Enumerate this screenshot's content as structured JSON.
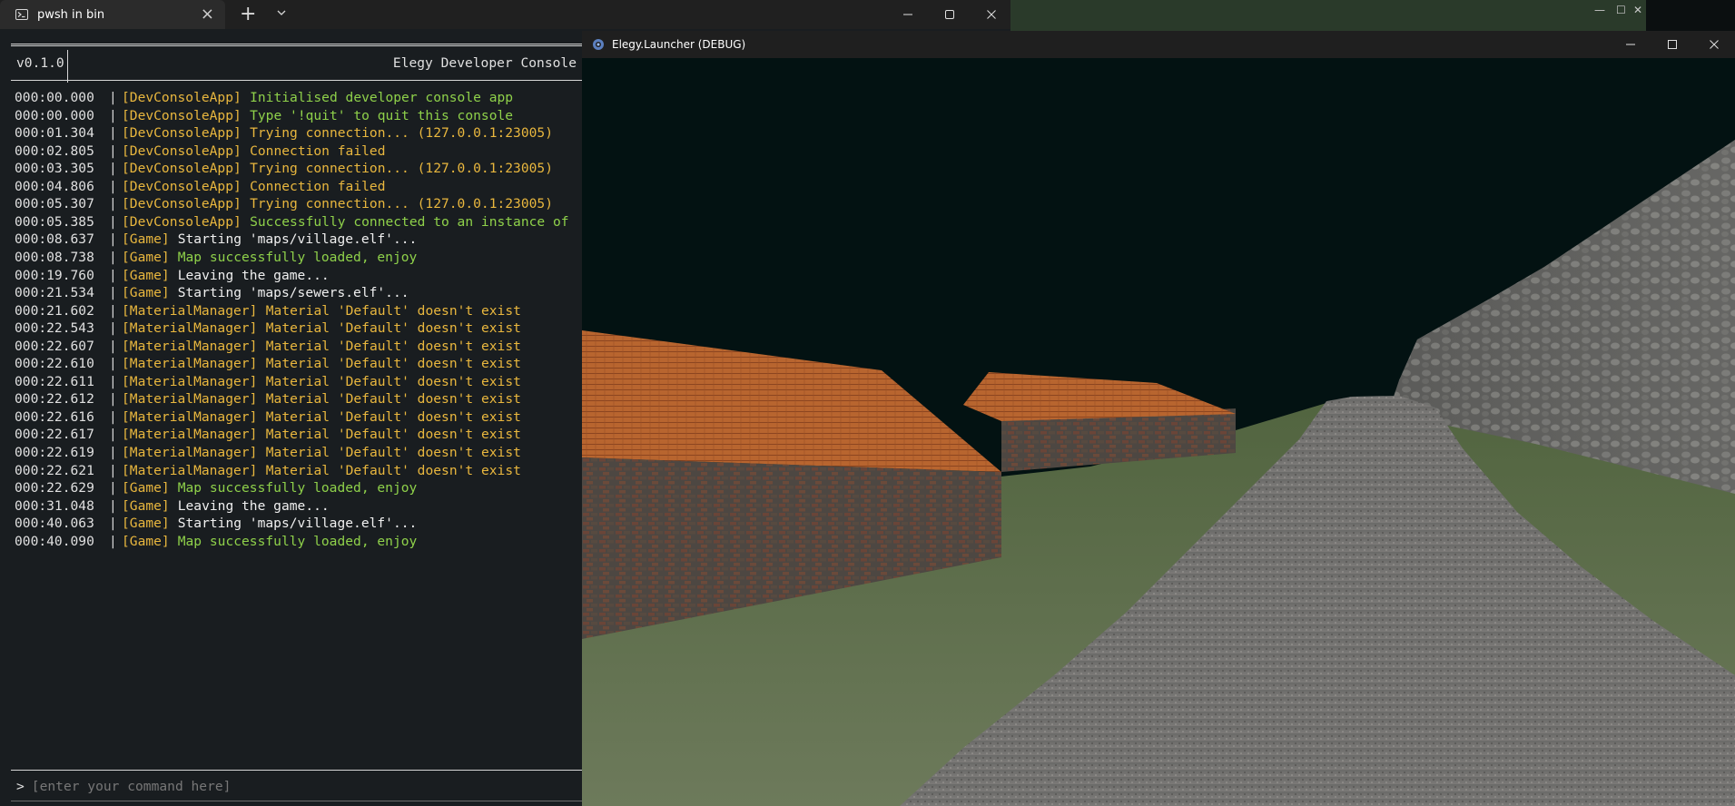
{
  "terminal": {
    "tab_title": "pwsh in bin",
    "tab_close": "×",
    "new_tab": "+",
    "console": {
      "version": "v0.1.0",
      "title": "Elegy Developer Console",
      "command_placeholder": "[enter your command here]",
      "prompt": ">",
      "log": [
        {
          "time": "000:00.000",
          "tag": "[DevConsoleApp]",
          "msg": "Initialised developer console app",
          "color": "green"
        },
        {
          "time": "000:00.000",
          "tag": "[DevConsoleApp]",
          "msg": "Type '!quit' to quit this console",
          "color": "green"
        },
        {
          "time": "000:01.304",
          "tag": "[DevConsoleApp]",
          "msg": "Trying connection... (127.0.0.1:23005)",
          "color": "yellow"
        },
        {
          "time": "000:02.805",
          "tag": "[DevConsoleApp]",
          "msg": "Connection failed",
          "color": "yellow"
        },
        {
          "time": "000:03.305",
          "tag": "[DevConsoleApp]",
          "msg": "Trying connection... (127.0.0.1:23005)",
          "color": "yellow"
        },
        {
          "time": "000:04.806",
          "tag": "[DevConsoleApp]",
          "msg": "Connection failed",
          "color": "yellow"
        },
        {
          "time": "000:05.307",
          "tag": "[DevConsoleApp]",
          "msg": "Trying connection... (127.0.0.1:23005)",
          "color": "yellow"
        },
        {
          "time": "000:05.385",
          "tag": "[DevConsoleApp]",
          "msg": "Successfully connected to an instance of",
          "color": "green"
        },
        {
          "time": "000:08.637",
          "tag": "[Game]",
          "msg": "Starting 'maps/village.elf'...",
          "color": "white"
        },
        {
          "time": "000:08.738",
          "tag": "[Game]",
          "msg": "Map successfully loaded, enjoy",
          "color": "green"
        },
        {
          "time": "000:19.760",
          "tag": "[Game]",
          "msg": "Leaving the game...",
          "color": "white"
        },
        {
          "time": "000:21.534",
          "tag": "[Game]",
          "msg": "Starting 'maps/sewers.elf'...",
          "color": "white"
        },
        {
          "time": "000:21.602",
          "tag": "[MaterialManager]",
          "msg": "Material 'Default' doesn't exist",
          "color": "yellow"
        },
        {
          "time": "000:22.543",
          "tag": "[MaterialManager]",
          "msg": "Material 'Default' doesn't exist",
          "color": "yellow"
        },
        {
          "time": "000:22.607",
          "tag": "[MaterialManager]",
          "msg": "Material 'Default' doesn't exist",
          "color": "yellow"
        },
        {
          "time": "000:22.610",
          "tag": "[MaterialManager]",
          "msg": "Material 'Default' doesn't exist",
          "color": "yellow"
        },
        {
          "time": "000:22.611",
          "tag": "[MaterialManager]",
          "msg": "Material 'Default' doesn't exist",
          "color": "yellow"
        },
        {
          "time": "000:22.612",
          "tag": "[MaterialManager]",
          "msg": "Material 'Default' doesn't exist",
          "color": "yellow"
        },
        {
          "time": "000:22.616",
          "tag": "[MaterialManager]",
          "msg": "Material 'Default' doesn't exist",
          "color": "yellow"
        },
        {
          "time": "000:22.617",
          "tag": "[MaterialManager]",
          "msg": "Material 'Default' doesn't exist",
          "color": "yellow"
        },
        {
          "time": "000:22.619",
          "tag": "[MaterialManager]",
          "msg": "Material 'Default' doesn't exist",
          "color": "yellow"
        },
        {
          "time": "000:22.621",
          "tag": "[MaterialManager]",
          "msg": "Material 'Default' doesn't exist",
          "color": "yellow"
        },
        {
          "time": "000:22.629",
          "tag": "[Game]",
          "msg": "Map successfully loaded, enjoy",
          "color": "green"
        },
        {
          "time": "000:31.048",
          "tag": "[Game]",
          "msg": "Leaving the game...",
          "color": "white"
        },
        {
          "time": "000:40.063",
          "tag": "[Game]",
          "msg": "Starting 'maps/village.elf'...",
          "color": "white"
        },
        {
          "time": "000:40.090",
          "tag": "[Game]",
          "msg": "Map successfully loaded, enjoy",
          "color": "green"
        }
      ]
    }
  },
  "game_window": {
    "title": "Elegy.Launcher (DEBUG)"
  },
  "colors": {
    "log_green": "#8fd14a",
    "log_yellow": "#e9b73e",
    "log_white": "#f0f0f0",
    "console_bg": "#191d20",
    "sky": "#031212"
  },
  "icons": [
    "powershell-icon",
    "close-icon",
    "plus-icon",
    "chevron-down-icon",
    "minimize-icon",
    "maximize-icon",
    "game-app-icon"
  ]
}
